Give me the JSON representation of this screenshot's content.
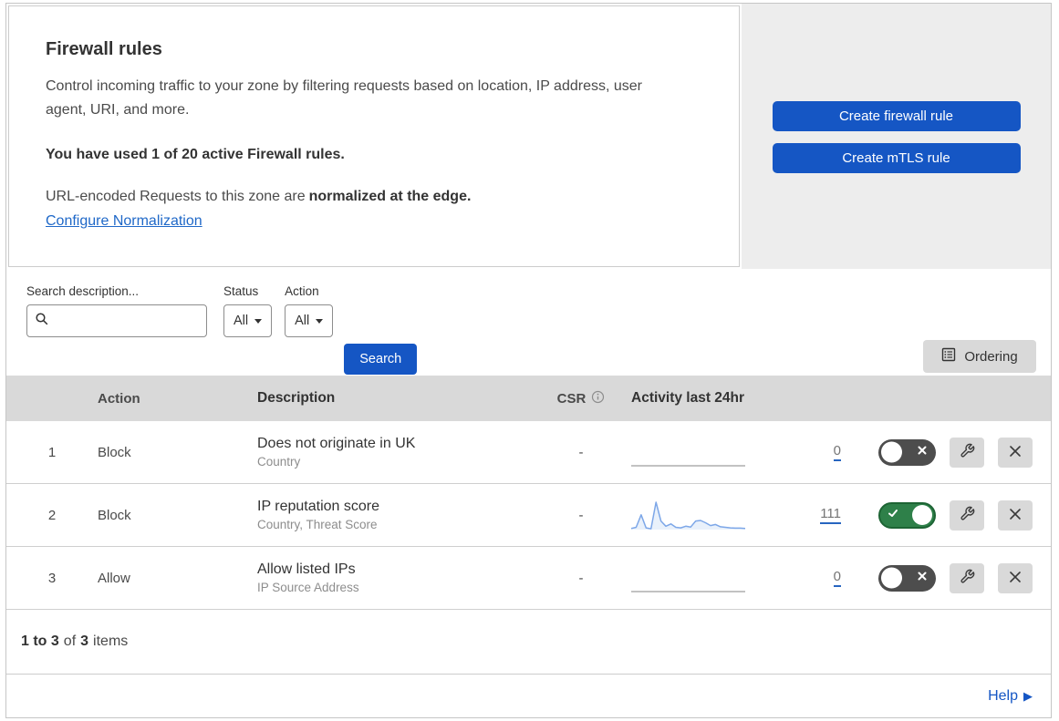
{
  "header": {
    "title": "Firewall rules",
    "description": "Control incoming traffic to your zone by filtering requests based on location, IP address, user agent, URI, and more.",
    "usage_notice": "You have used 1 of 20 active Firewall rules.",
    "normalization_prefix": "URL-encoded Requests to this zone are",
    "normalization_bold": "normalized at the edge.",
    "normalization_link": "Configure Normalization"
  },
  "actions_panel": {
    "create_firewall_rule_label": "Create firewall rule",
    "create_mtls_rule_label": "Create mTLS rule"
  },
  "filters": {
    "search_label": "Search description...",
    "search_value": "",
    "status_label": "Status",
    "status_value": "All",
    "action_label": "Action",
    "action_value": "All",
    "search_button_label": "Search",
    "ordering_button_label": "Ordering"
  },
  "table": {
    "headers": {
      "action": "Action",
      "description": "Description",
      "csr": "CSR",
      "activity": "Activity last 24hr"
    },
    "rows": [
      {
        "num": "1",
        "action": "Block",
        "title": "Does not originate in UK",
        "subtitle": "Country",
        "csr": "-",
        "count": "0",
        "enabled": false,
        "sparkline": [
          0,
          0
        ]
      },
      {
        "num": "2",
        "action": "Block",
        "title": "IP reputation score",
        "subtitle": "Country, Threat Score",
        "csr": "-",
        "count": "111",
        "enabled": true,
        "sparkline": [
          4,
          8,
          52,
          6,
          3,
          96,
          30,
          12,
          20,
          8,
          6,
          12,
          9,
          30,
          32,
          24,
          14,
          18,
          10,
          8,
          6,
          5,
          5,
          4
        ]
      },
      {
        "num": "3",
        "action": "Allow",
        "title": "Allow listed IPs",
        "subtitle": "IP Source Address",
        "csr": "-",
        "count": "0",
        "enabled": false,
        "sparkline": [
          0,
          0
        ]
      }
    ]
  },
  "footer": {
    "range": "1 to 3",
    "of_label": "of",
    "total": "3",
    "items_label": "items"
  },
  "help_bar": {
    "label": "Help",
    "arrow": "▶"
  },
  "colors": {
    "accent_blue": "#1556c4",
    "link_blue": "#1f68c8",
    "toggle_on_green": "#2e8049",
    "toggle_off_gray": "#4d4d4d",
    "spark_line": "#7da7e8",
    "spark_fill": "#e9f1fb",
    "spark_flat": "#9e9e9e",
    "count_underline": "#2765c0",
    "panel_gray": "#ededed",
    "table_header_gray": "#d9d9d9"
  }
}
